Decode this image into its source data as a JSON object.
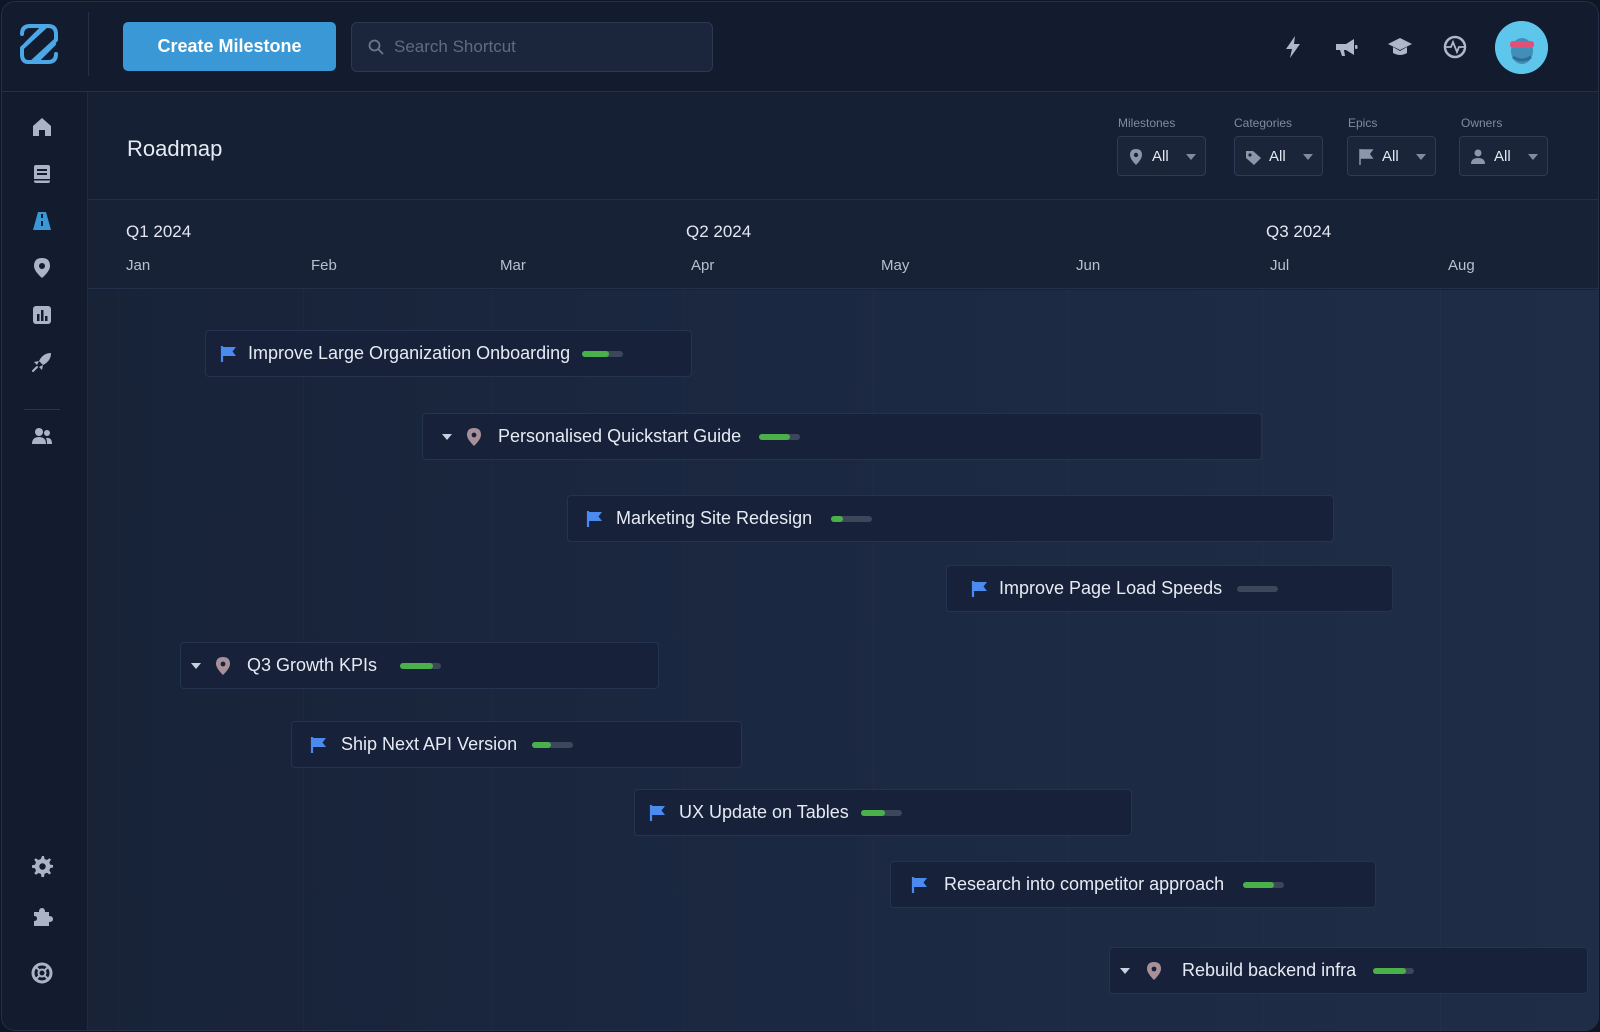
{
  "topbar": {
    "create_label": "Create Milestone",
    "search_placeholder": "Search Shortcut",
    "icons": [
      "lightning-icon",
      "megaphone-icon",
      "graduation-cap-icon",
      "activity-icon"
    ]
  },
  "sidebar": {
    "items": [
      "home-icon",
      "stories-icon",
      "roadmap-icon",
      "milestones-icon",
      "reports-icon",
      "launch-icon",
      "team-icon",
      "settings-icon",
      "integrations-icon",
      "help-icon"
    ],
    "active": "roadmap-icon"
  },
  "header": {
    "title": "Roadmap",
    "filters": [
      {
        "label": "Milestones",
        "value": "All",
        "icon": "pin-icon"
      },
      {
        "label": "Categories",
        "value": "All",
        "icon": "tag-icon"
      },
      {
        "label": "Epics",
        "value": "All",
        "icon": "flag-icon"
      },
      {
        "label": "Owners",
        "value": "All",
        "icon": "person-icon"
      }
    ]
  },
  "timeline": {
    "quarters": [
      "Q1 2024",
      "Q2 2024",
      "Q3 2024"
    ],
    "months": [
      "Jan",
      "Feb",
      "Mar",
      "Apr",
      "May",
      "Jun",
      "Jul",
      "Aug"
    ]
  },
  "rows": [
    {
      "label": "Improve Large Organization Onboarding",
      "kind": "epic",
      "progress": 0.65
    },
    {
      "label": "Personalised Quickstart Guide",
      "kind": "milestone",
      "progress": 0.75
    },
    {
      "label": "Marketing Site Redesign",
      "kind": "epic",
      "progress": 0.3
    },
    {
      "label": "Improve Page Load Speeds",
      "kind": "epic",
      "progress": 0
    },
    {
      "label": "Q3 Growth KPIs",
      "kind": "milestone",
      "progress": 0.8
    },
    {
      "label": "Ship Next API Version",
      "kind": "epic",
      "progress": 0.45
    },
    {
      "label": "UX Update on Tables",
      "kind": "epic",
      "progress": 0.6
    },
    {
      "label": "Research into competitor approach",
      "kind": "epic",
      "progress": 0.75
    },
    {
      "label": "Rebuild backend infra",
      "kind": "milestone",
      "progress": 0.8
    }
  ],
  "colors": {
    "accent": "#3a98d6",
    "flag": "#4b8bf0",
    "progress": "#4ab04a",
    "pin": "#a8909b"
  }
}
